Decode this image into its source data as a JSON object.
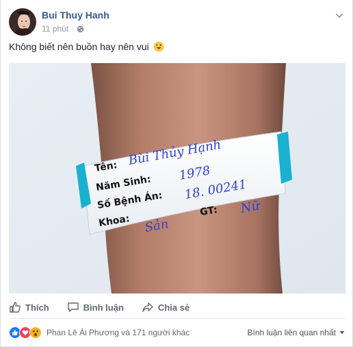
{
  "post": {
    "author": "Bui Thuy Hanh",
    "time": "11 phút",
    "time_separator": "·",
    "privacy_icon": "globe-icon",
    "caption": "Không biết nên buồn hay nên vui",
    "caption_emoji": "winking-tongue-emoji",
    "photo": {
      "wristband": {
        "label_name": "Tên:",
        "value_name": "Bùi Thủy Hạnh",
        "label_birth": "Năm Sinh:",
        "value_birth": "1978",
        "label_record": "Số Bệnh Án:",
        "value_record": "18. 00241",
        "label_dept": "Khoa:",
        "value_dept": "Sản",
        "label_sex": "GT:",
        "value_sex": "Nữ"
      }
    }
  },
  "actions": {
    "like": "Thích",
    "comment": "Bình luận",
    "share": "Chia sẻ"
  },
  "footer": {
    "likers": "Phan Lê Ái Phương và 171 người khác",
    "sort": "Bình luận liên quan nhất",
    "sort_icon": "caret-down-icon",
    "reaction_icons": [
      "like-reaction-icon",
      "love-reaction-icon",
      "wow-reaction-icon"
    ]
  },
  "colors": {
    "link": "#365899",
    "muted": "#90949c",
    "action": "#606770",
    "like": "#1877f2",
    "love": "#f33e58",
    "wow": "#f7b125",
    "pen_ink": "#2d3fd4",
    "band_clip": "#1ab1d0"
  }
}
